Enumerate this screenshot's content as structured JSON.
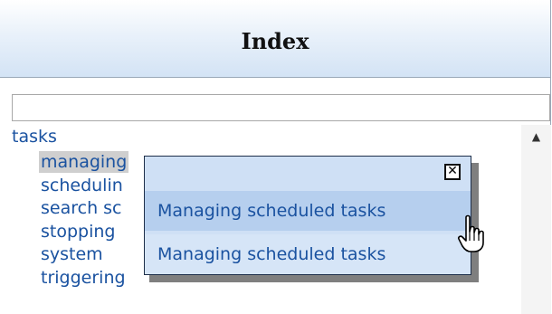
{
  "header": {
    "title": "Index"
  },
  "search": {
    "value": "",
    "placeholder": ""
  },
  "tree": {
    "root": "tasks",
    "children": [
      "managing",
      "schedulin",
      "search sc",
      "stopping",
      "system",
      "triggering"
    ],
    "selected_index": 0
  },
  "popup": {
    "close_glyph": "✕",
    "items": [
      "Managing scheduled tasks",
      "Managing scheduled tasks"
    ]
  },
  "scrollbar": {
    "up_glyph": "▲"
  },
  "icons": {
    "cursor": "hand-pointer-icon"
  }
}
